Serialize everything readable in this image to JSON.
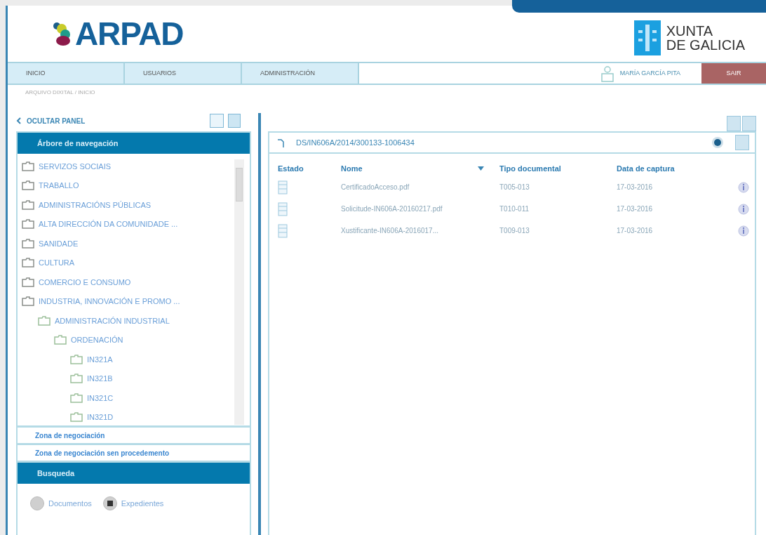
{
  "header": {
    "logo": "ARPAD",
    "org_line1": "XUNTA",
    "org_line2": "DE GALICIA"
  },
  "nav": {
    "tabs": [
      {
        "label": "INICIO",
        "selected": false
      },
      {
        "label": "USUARIOS",
        "selected": false
      },
      {
        "label": "ADMINISTRACIÓN",
        "selected": false
      }
    ],
    "user": "MARÍA GARCÍA PITA",
    "logout": "SAIR"
  },
  "breadcrumb": "ARQUIVO DIXITAL / INICIO",
  "sidebar": {
    "hide": "OCULTAR PANEL",
    "tree_title": "Árbore de navegación",
    "tree": [
      {
        "label": "SERVIZOS SOCIAIS"
      },
      {
        "label": "TRABALLO"
      },
      {
        "label": "ADMINISTRACIÓNS PÚBLICAS"
      },
      {
        "label": "ALTA DIRECCIÓN DA COMUNIDADE ..."
      },
      {
        "label": "SANIDADE"
      },
      {
        "label": "CULTURA"
      },
      {
        "label": "COMERCIO E CONSUMO"
      },
      {
        "label": "INDUSTRIA, INNOVACIÓN E PROMO ...",
        "children": [
          {
            "label": "ADMINISTRACIÓN INDUSTRIAL",
            "children": [
              {
                "label": "ORDENACIÓN",
                "children": [
                  {
                    "label": "IN321A"
                  },
                  {
                    "label": "IN321B"
                  },
                  {
                    "label": "IN321C"
                  },
                  {
                    "label": "IN321D"
                  }
                ]
              }
            ]
          }
        ]
      }
    ],
    "sections": [
      "Zona de negociación",
      "Zona de negociación sen procedemento"
    ],
    "search_title": "Busqueda",
    "search_options": [
      {
        "label": "Documentos",
        "selected": false
      },
      {
        "label": "Expedientes",
        "selected": true
      }
    ]
  },
  "content": {
    "path": "DS/IN606A/2014/300133-1006434",
    "columns": [
      "Estado",
      "Nome",
      "Tipo documental",
      "Data de captura"
    ],
    "rows": [
      {
        "name": "CertificadoAcceso.pdf",
        "type": "T005-013",
        "date": "17-03-2016"
      },
      {
        "name": "Solicitude-IN606A-20160217.pdf",
        "type": "T010-011",
        "date": "17-03-2016"
      },
      {
        "name": "Xustificante-IN606A-2016017...",
        "type": "T009-013",
        "date": "17-03-2016"
      }
    ]
  }
}
